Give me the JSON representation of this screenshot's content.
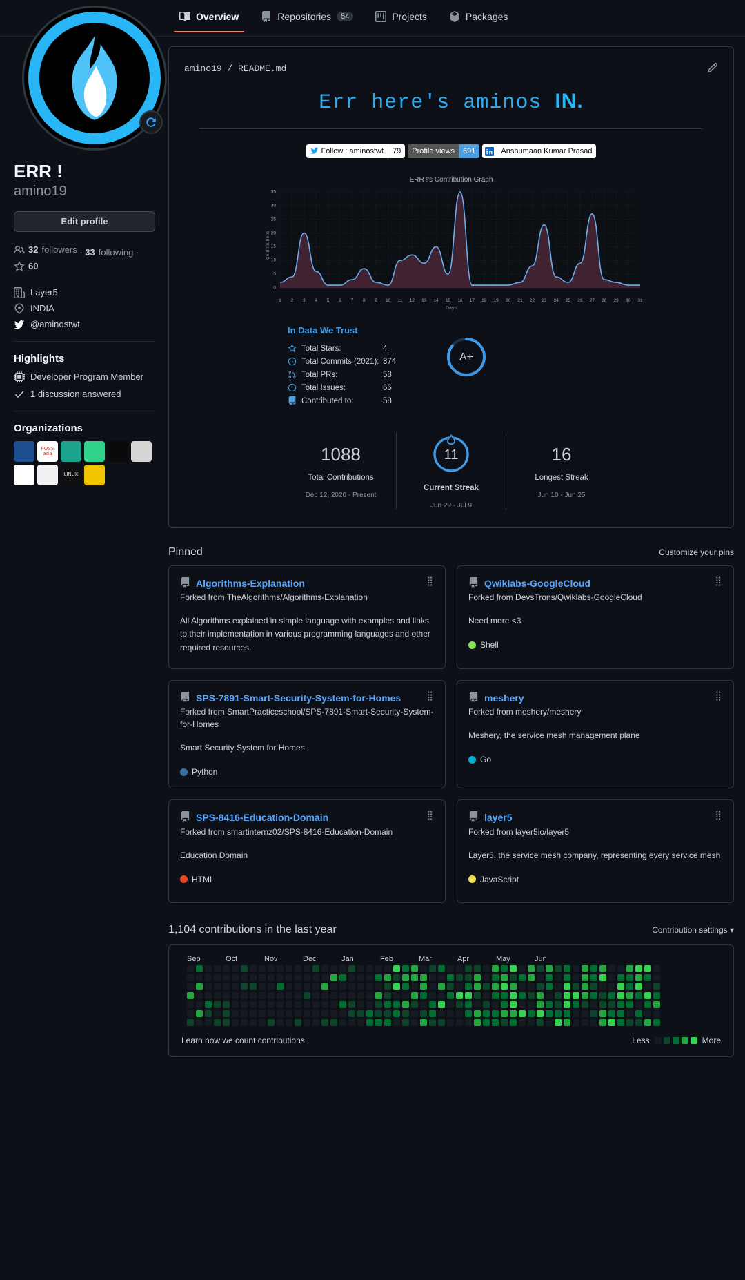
{
  "nav": {
    "tabs": [
      {
        "label": "Overview",
        "icon": "book-icon",
        "count": null,
        "active": true
      },
      {
        "label": "Repositories",
        "icon": "repo-icon",
        "count": "54",
        "active": false
      },
      {
        "label": "Projects",
        "icon": "project-icon",
        "count": null,
        "active": false
      },
      {
        "label": "Packages",
        "icon": "package-icon",
        "count": null,
        "active": false
      }
    ]
  },
  "profile": {
    "full_name": "ERR !",
    "username": "amino19",
    "edit_button": "Edit profile",
    "followers": "32",
    "followers_label": "followers",
    "following": "33",
    "following_label": "following",
    "stars": "60",
    "company": "Layer5",
    "location": "INDIA",
    "twitter": "@aminostwt",
    "highlights_title": "Highlights",
    "highlights": [
      {
        "label": "Developer Program Member",
        "icon": "cpu-icon"
      },
      {
        "label": "1 discussion answered",
        "icon": "check-icon"
      }
    ],
    "organizations_title": "Organizations",
    "organizations": [
      {
        "name": "layer5",
        "text": "",
        "bg": "#1d4e8f",
        "fg": "#ffffff"
      },
      {
        "name": "fossasia",
        "text": "FOSS asia",
        "bg": "#ffffff",
        "fg": "#d9392b"
      },
      {
        "name": "org3",
        "text": "",
        "bg": "#1aa38a",
        "fg": "#ffffff"
      },
      {
        "name": "org4",
        "text": "",
        "bg": "#2fd38a",
        "fg": "#0b2a18"
      },
      {
        "name": "org5",
        "text": "",
        "bg": "#0a0a0a",
        "fg": "#ffffff"
      },
      {
        "name": "org6",
        "text": "",
        "bg": "#d6d6d6",
        "fg": "#222222"
      },
      {
        "name": "org7",
        "text": "",
        "bg": "#ffffff",
        "fg": "#1f6feb"
      },
      {
        "name": "org8",
        "text": "",
        "bg": "#f0f0f0",
        "fg": "#111111"
      },
      {
        "name": "org9",
        "text": "LINUX",
        "bg": "#101010",
        "fg": "#eeeeee"
      },
      {
        "name": "org10",
        "text": "",
        "bg": "#f2c300",
        "fg": "#222222"
      }
    ]
  },
  "readme": {
    "path_owner": "amino19",
    "path_sep": "/",
    "path_file": "README.md",
    "edit_icon": "pencil-icon",
    "heading": "Err here's aminos",
    "heading_mark": "IN",
    "heading_dot": ".",
    "badges": [
      {
        "left": "Follow : aminostwt",
        "right": "79",
        "left_bg": "#ffffff",
        "left_fg": "#111111",
        "right_bg": "#ffffff",
        "right_fg": "#111111",
        "icon": "twitter-icon"
      },
      {
        "left": "Profile views",
        "right": "691",
        "left_bg": "#555555",
        "left_fg": "#ffffff",
        "right_bg": "#4c9fe0",
        "right_fg": "#ffffff",
        "icon": ""
      },
      {
        "left": "",
        "right": "Anshumaan Kumar Prasad",
        "left_bg": "#ffffff",
        "left_fg": "#0a66c2",
        "right_bg": "#ffffff",
        "right_fg": "#111111",
        "icon": "linkedin-icon"
      }
    ]
  },
  "chart_data": {
    "type": "area",
    "title": "ERR !'s Contribution Graph",
    "xlabel": "Days",
    "ylabel": "Contributions",
    "ylim": [
      0,
      35
    ],
    "yticks": [
      0,
      5,
      10,
      15,
      20,
      25,
      30,
      35
    ],
    "grid": true,
    "legend": "none",
    "line_color": "#6aaef0",
    "fill_color": "#4b2636",
    "categories": [
      "1",
      "2",
      "3",
      "4",
      "5",
      "6",
      "7",
      "8",
      "9",
      "10",
      "11",
      "12",
      "13",
      "14",
      "15",
      "16",
      "17",
      "18",
      "19",
      "20",
      "21",
      "22",
      "23",
      "24",
      "25",
      "26",
      "27",
      "28",
      "29",
      "30",
      "31"
    ],
    "values": [
      2,
      4,
      20,
      6,
      1,
      1,
      3,
      7,
      2,
      1,
      10,
      12,
      9,
      15,
      5,
      35,
      1,
      1,
      1,
      1,
      2,
      8,
      23,
      4,
      2,
      9,
      27,
      3,
      2,
      1,
      1
    ]
  },
  "stats": {
    "title": "In Data We Trust",
    "rows": [
      {
        "icon": "star-icon",
        "label": "Total Stars:",
        "value": "4"
      },
      {
        "icon": "clock-icon",
        "label": "Total Commits (2021):",
        "value": "874"
      },
      {
        "icon": "pr-icon",
        "label": "Total PRs:",
        "value": "58"
      },
      {
        "icon": "issue-icon",
        "label": "Total Issues:",
        "value": "66"
      },
      {
        "icon": "repo-icon",
        "label": "Contributed to:",
        "value": "58"
      }
    ],
    "grade": "A+"
  },
  "streaks": {
    "total_value": "1088",
    "total_label": "Total Contributions",
    "total_range": "Dec 12, 2020 - Present",
    "current_value": "11",
    "current_label": "Current Streak",
    "current_range": "Jun 29 - Jul 9",
    "longest_value": "16",
    "longest_label": "Longest Streak",
    "longest_range": "Jun 10 - Jun 25"
  },
  "pinned": {
    "title": "Pinned",
    "customize": "Customize your pins",
    "cards": [
      {
        "name": "Algorithms-Explanation",
        "forked_from": "Forked from TheAlgorithms/Algorithms-Explanation",
        "description": "All Algorithms explained in simple language with examples and links to their implementation in various programming languages and other required resources.",
        "language": "",
        "lang_color": ""
      },
      {
        "name": "Qwiklabs-GoogleCloud",
        "forked_from": "Forked from DevsTrons/Qwiklabs-GoogleCloud",
        "description": "Need more <3",
        "language": "Shell",
        "lang_color": "#89e051"
      },
      {
        "name": "SPS-7891-Smart-Security-System-for-Homes",
        "forked_from": "Forked from SmartPracticeschool/SPS-7891-Smart-Security-System-for-Homes",
        "description": "Smart Security System for Homes",
        "language": "Python",
        "lang_color": "#3572A5"
      },
      {
        "name": "meshery",
        "forked_from": "Forked from meshery/meshery",
        "description": "Meshery, the service mesh management plane",
        "language": "Go",
        "lang_color": "#00ADD8"
      },
      {
        "name": "SPS-8416-Education-Domain",
        "forked_from": "Forked from smartinternz02/SPS-8416-Education-Domain",
        "description": "Education Domain",
        "language": "HTML",
        "lang_color": "#e34c26"
      },
      {
        "name": "layer5",
        "forked_from": "Forked from layer5io/layer5",
        "description": "Layer5, the service mesh company, representing every service mesh",
        "language": "JavaScript",
        "lang_color": "#f1e05a"
      }
    ]
  },
  "contributions": {
    "heading": "1,104 contributions in the last year",
    "settings": "Contribution settings",
    "settings_caret": "▾",
    "months": [
      "Sep",
      "Oct",
      "Nov",
      "Dec",
      "Jan",
      "Feb",
      "Mar",
      "Apr",
      "May",
      "Jun"
    ],
    "learn_more": "Learn how we count contributions",
    "less": "Less",
    "more": "More",
    "levels": [
      "#161b22",
      "#0e4429",
      "#006d32",
      "#26a641",
      "#39d353"
    ]
  }
}
